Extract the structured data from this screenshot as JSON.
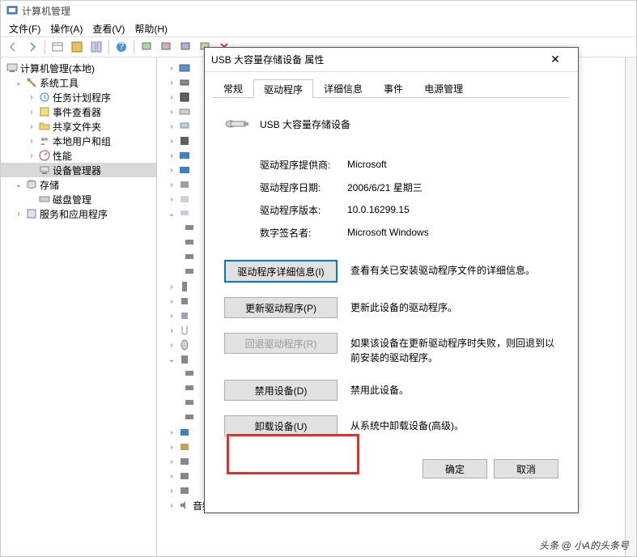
{
  "window": {
    "title": "计算机管理"
  },
  "menu": {
    "file": "文件(F)",
    "action": "操作(A)",
    "view": "查看(V)",
    "help": "帮助(H)"
  },
  "tree": {
    "root": "计算机管理(本地)",
    "systools": "系统工具",
    "scheduler": "任务计划程序",
    "eventviewer": "事件查看器",
    "shared": "共享文件夹",
    "users": "本地用户和组",
    "perf": "性能",
    "devmgr": "设备管理器",
    "storage": "存储",
    "diskmgr": "磁盘管理",
    "services": "服务和应用程序"
  },
  "devlist": {
    "last": "音频输入和输出"
  },
  "dialog": {
    "title": "USB 大容量存储设备 属性",
    "tabs": {
      "general": "常规",
      "driver": "驱动程序",
      "details": "详细信息",
      "events": "事件",
      "power": "电源管理"
    },
    "device_name": "USB 大容量存储设备",
    "provider_label": "驱动程序提供商:",
    "provider_value": "Microsoft",
    "date_label": "驱动程序日期:",
    "date_value": "2006/6/21 星期三",
    "version_label": "驱动程序版本:",
    "version_value": "10.0.16299.15",
    "signer_label": "数字签名者:",
    "signer_value": "Microsoft Windows",
    "btn_details": "驱动程序详细信息(I)",
    "desc_details": "查看有关已安装驱动程序文件的详细信息。",
    "btn_update": "更新驱动程序(P)",
    "desc_update": "更新此设备的驱动程序。",
    "btn_rollback": "回退驱动程序(R)",
    "desc_rollback": "如果该设备在更新驱动程序时失败，则回退到以前安装的驱动程序。",
    "btn_disable": "禁用设备(D)",
    "desc_disable": "禁用此设备。",
    "btn_uninstall": "卸载设备(U)",
    "desc_uninstall": "从系统中卸载设备(高级)。",
    "ok": "确定",
    "cancel": "取消"
  },
  "watermark": "头条 @ 小A的头条号"
}
